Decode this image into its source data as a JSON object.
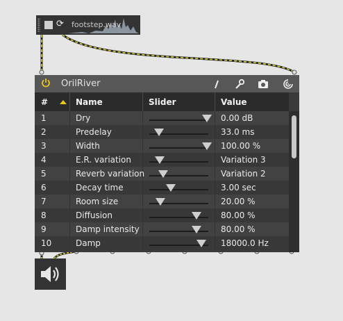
{
  "player": {
    "filename": "footstep.wav",
    "stop_icon": "stop-square-icon",
    "loop_icon": "loop-arrows-icon"
  },
  "device": {
    "title": "OrilRiver",
    "power_icon": "power-icon",
    "toolbar_icons": [
      "pencil-icon",
      "wrench-icon",
      "camera-icon",
      "preset-icon"
    ],
    "accent": "#e8c81e",
    "table": {
      "headers": {
        "num": "#",
        "name": "Name",
        "slider": "Slider",
        "value": "Value"
      },
      "rows": [
        {
          "num": "1",
          "name": "Dry",
          "value": "0.00 dB",
          "level": 0.98
        },
        {
          "num": "2",
          "name": "Predelay",
          "value": "33.0 ms",
          "level": 0.16
        },
        {
          "num": "3",
          "name": "Width",
          "value": "100.00 %",
          "level": 0.98
        },
        {
          "num": "4",
          "name": "E.R. variation",
          "value": "Variation 3",
          "level": 0.18
        },
        {
          "num": "5",
          "name": "Reverb variation",
          "value": "Variation 2",
          "level": 0.24
        },
        {
          "num": "6",
          "name": "Decay time",
          "value": "3.00 sec",
          "level": 0.36
        },
        {
          "num": "7",
          "name": "Room size",
          "value": "20.00 %",
          "level": 0.19
        },
        {
          "num": "8",
          "name": "Diffusion",
          "value": "80.00 %",
          "level": 0.8
        },
        {
          "num": "9",
          "name": "Damp intensity",
          "value": "80.00 %",
          "level": 0.8
        },
        {
          "num": "10",
          "name": "Damp",
          "value": "18000.0 Hz",
          "level": 0.88
        }
      ]
    }
  },
  "speaker": {
    "icon": "speaker-volume-icon"
  }
}
